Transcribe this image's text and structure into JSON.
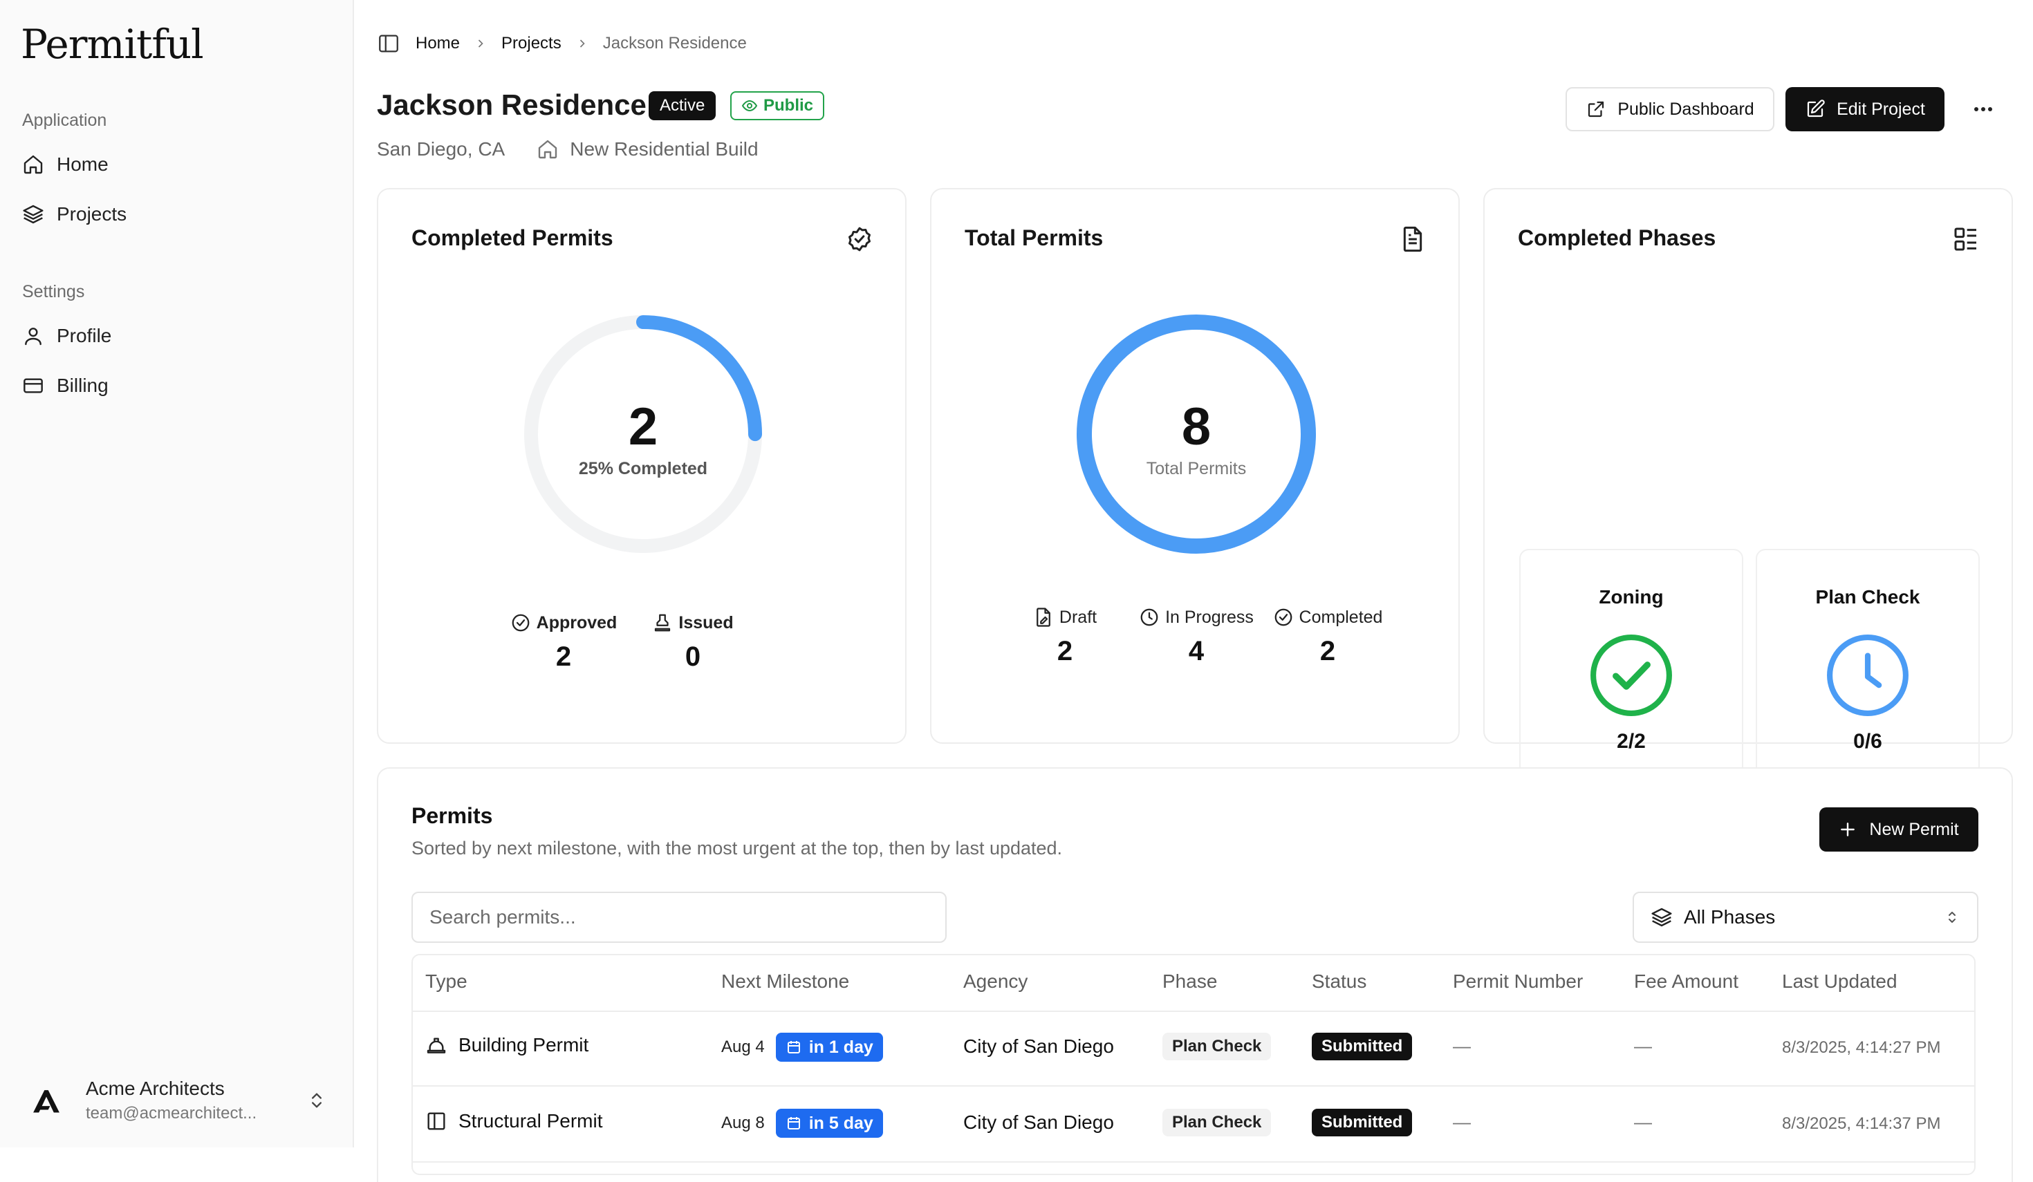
{
  "app": {
    "logo": "Permitful"
  },
  "sidebar": {
    "groups": [
      {
        "label": "Application",
        "items": [
          {
            "label": "Home",
            "icon": "home-icon"
          },
          {
            "label": "Projects",
            "icon": "layers-icon"
          }
        ]
      },
      {
        "label": "Settings",
        "items": [
          {
            "label": "Profile",
            "icon": "user-icon"
          },
          {
            "label": "Billing",
            "icon": "credit-card-icon"
          }
        ]
      }
    ],
    "org": {
      "name": "Acme Architects",
      "email": "team@acmearchitect..."
    }
  },
  "breadcrumb": [
    "Home",
    "Projects",
    "Jackson Residence"
  ],
  "project": {
    "title": "Jackson Residence",
    "status_badge": "Active",
    "visibility_badge": "Public",
    "location": "San Diego, CA",
    "type": "New Residential Build"
  },
  "actions": {
    "public_dashboard": "Public Dashboard",
    "edit_project": "Edit Project"
  },
  "colors": {
    "accent_blue": "#4b9cf5",
    "pill_blue": "#1e6bf0",
    "success_green": "#1fb24a",
    "dark": "#111111"
  },
  "completed_permits": {
    "title": "Completed Permits",
    "value": "2",
    "caption": "25% Completed",
    "progress": 0.25,
    "stats": [
      {
        "label": "Approved",
        "value": "2",
        "icon": "check-circle-icon"
      },
      {
        "label": "Issued",
        "value": "0",
        "icon": "stamp-icon"
      }
    ]
  },
  "total_permits": {
    "title": "Total Permits",
    "value": "8",
    "caption": "Total Permits",
    "stats": [
      {
        "label": "Draft",
        "value": "2",
        "icon": "file-pen-icon"
      },
      {
        "label": "In Progress",
        "value": "4",
        "icon": "clock-icon"
      },
      {
        "label": "Completed",
        "value": "2",
        "icon": "check-circle-icon"
      }
    ]
  },
  "completed_phases": {
    "title": "Completed Phases",
    "phases": [
      {
        "name": "Zoning",
        "count": "2/2",
        "icon": "check-circle-icon"
      },
      {
        "name": "Plan Check",
        "count": "0/6",
        "icon": "clock-icon"
      }
    ]
  },
  "permits": {
    "title": "Permits",
    "description": "Sorted by next milestone, with the most urgent at the top, then by last updated.",
    "new_button": "New Permit",
    "search_placeholder": "Search permits...",
    "phase_filter": "All Phases",
    "columns": [
      "Type",
      "Next Milestone",
      "Agency",
      "Phase",
      "Status",
      "Permit Number",
      "Fee Amount",
      "Last Updated"
    ],
    "rows": [
      {
        "type": "Building Permit",
        "type_icon": "hard-hat-icon",
        "milestone_date": "Aug 4",
        "milestone_rel": "in 1 day",
        "agency": "City of San Diego",
        "phase": "Plan Check",
        "status": "Submitted",
        "permit_number": "—",
        "fee": "—",
        "updated": "8/3/2025, 4:14:27 PM"
      },
      {
        "type": "Structural Permit",
        "type_icon": "columns-icon",
        "milestone_date": "Aug 8",
        "milestone_rel": "in 5 day",
        "agency": "City of San Diego",
        "phase": "Plan Check",
        "status": "Submitted",
        "permit_number": "—",
        "fee": "—",
        "updated": "8/3/2025, 4:14:37 PM"
      }
    ]
  }
}
